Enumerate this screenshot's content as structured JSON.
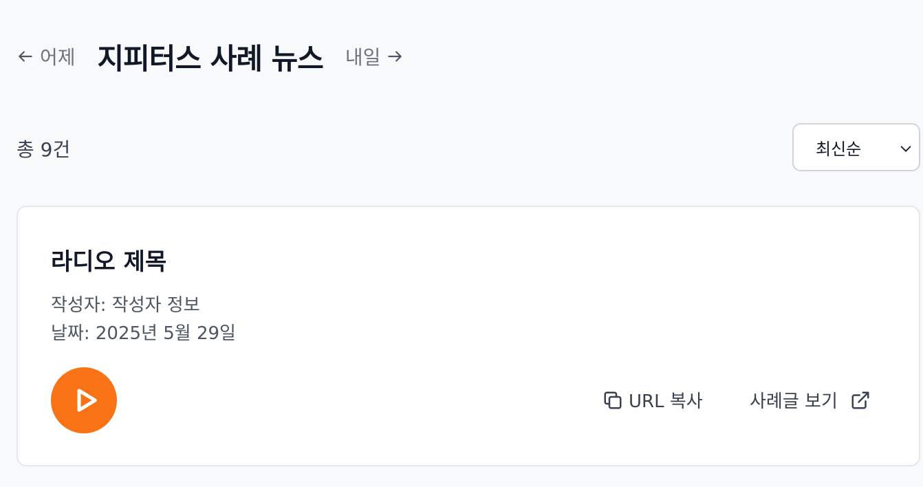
{
  "header": {
    "prev_label": "어제",
    "title": "지피터스 사례 뉴스",
    "next_label": "내일"
  },
  "list": {
    "count_label": "총 9건",
    "sort": {
      "selected": "최신순"
    }
  },
  "card": {
    "title": "라디오 제목",
    "author_line": "작성자: 작성자 정보",
    "date_line": "날짜: 2025년 5월 29일",
    "copy_url_label": "URL 복사",
    "view_post_label": "사례글 보기"
  },
  "icons": {
    "prev": "arrow-left-icon",
    "next": "arrow-right-icon",
    "sort": "chevron-down-icon",
    "play": "play-icon",
    "copy": "copy-icon",
    "external": "external-link-icon"
  },
  "colors": {
    "accent": "#f97316",
    "background": "#f8f9fb",
    "card_border": "#e5e7eb"
  }
}
